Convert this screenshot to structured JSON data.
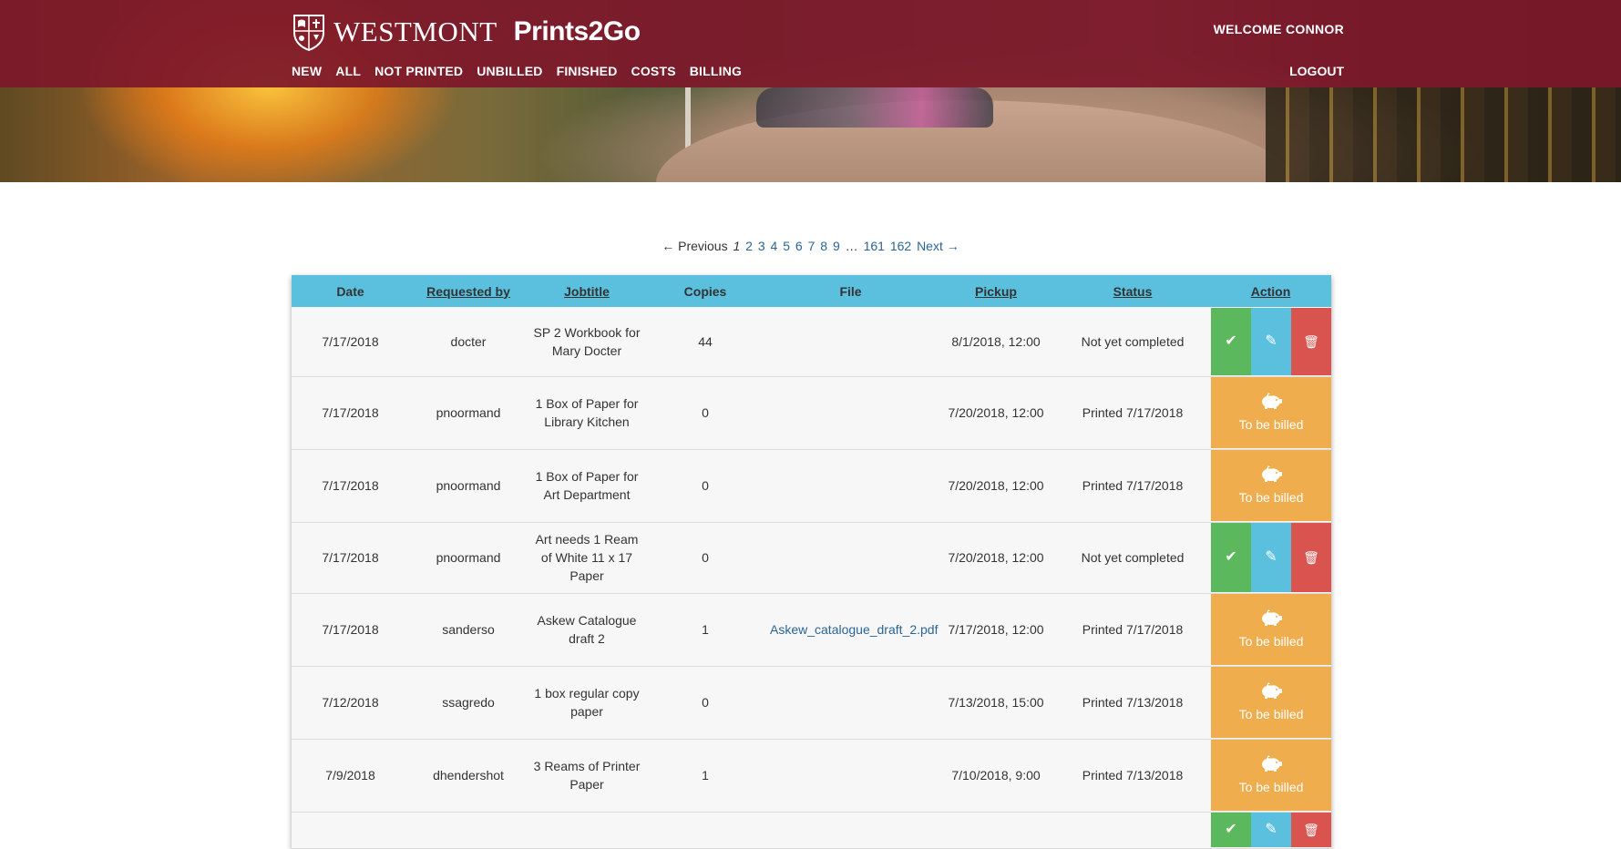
{
  "brand": {
    "wordmark": "WESTMONT",
    "app_name": "Prints2Go",
    "shield_icon": "westmont-shield-icon"
  },
  "header": {
    "welcome": "WELCOME CONNOR",
    "logout": "LOGOUT",
    "nav": [
      "NEW",
      "ALL",
      "NOT PRINTED",
      "UNBILLED",
      "FINISHED",
      "COSTS",
      "BILLING"
    ],
    "bar_color": "#7d182a"
  },
  "pagination": {
    "previous": "← Previous",
    "current": "1",
    "pages_before_gap": [
      "2",
      "3",
      "4",
      "5",
      "6",
      "7",
      "8",
      "9"
    ],
    "gap": "…",
    "pages_after_gap": [
      "161",
      "162"
    ],
    "next": "Next →"
  },
  "table": {
    "columns": [
      "Date",
      "Requested by",
      "Jobtitle",
      "Copies",
      "File",
      "Pickup",
      "Status",
      "Action"
    ],
    "sortable": [
      false,
      true,
      true,
      false,
      false,
      true,
      true,
      true
    ],
    "rows": [
      {
        "date": "7/17/2018",
        "requested_by": "docter",
        "jobtitle": "SP 2 Workbook for Mary Docter",
        "copies": "44",
        "file": "",
        "pickup": "8/1/2018, 12:00",
        "status": "Not yet completed",
        "action": "buttons"
      },
      {
        "date": "7/17/2018",
        "requested_by": "pnoormand",
        "jobtitle": "1 Box of Paper for Library Kitchen",
        "copies": "0",
        "file": "",
        "pickup": "7/20/2018, 12:00",
        "status": "Printed 7/17/2018",
        "action": "bill"
      },
      {
        "date": "7/17/2018",
        "requested_by": "pnoormand",
        "jobtitle": "1 Box of Paper for Art Department",
        "copies": "0",
        "file": "",
        "pickup": "7/20/2018, 12:00",
        "status": "Printed 7/17/2018",
        "action": "bill"
      },
      {
        "date": "7/17/2018",
        "requested_by": "pnoormand",
        "jobtitle": "Art needs 1 Ream of White 11 x 17 Paper",
        "copies": "0",
        "file": "",
        "pickup": "7/20/2018, 12:00",
        "status": "Not yet completed",
        "action": "buttons"
      },
      {
        "date": "7/17/2018",
        "requested_by": "sanderso",
        "jobtitle": "Askew Catalogue draft 2",
        "copies": "1",
        "file": "Askew_catalogue_draft_2.pdf",
        "pickup": "7/17/2018, 12:00",
        "status": "Printed 7/17/2018",
        "action": "bill"
      },
      {
        "date": "7/12/2018",
        "requested_by": "ssagredo",
        "jobtitle": "1 box regular copy paper",
        "copies": "0",
        "file": "",
        "pickup": "7/13/2018, 15:00",
        "status": "Printed 7/13/2018",
        "action": "bill"
      },
      {
        "date": "7/9/2018",
        "requested_by": "dhendershot",
        "jobtitle": "3 Reams of Printer Paper",
        "copies": "1",
        "file": "",
        "pickup": "7/10/2018, 9:00",
        "status": "Printed 7/13/2018",
        "action": "bill"
      },
      {
        "date": "",
        "requested_by": "",
        "jobtitle": "",
        "copies": "",
        "file": "",
        "pickup": "",
        "status": "",
        "action": "buttons"
      }
    ],
    "bill_label": "To be billed",
    "icons": {
      "complete": "checkmark-icon",
      "edit": "pencil-icon",
      "delete": "trash-icon",
      "bill": "piggy-bank-icon"
    },
    "colors": {
      "header": "#5bc0de",
      "complete": "#5cb85c",
      "edit": "#5bc0de",
      "delete": "#d9534f",
      "bill": "#f0ad4e"
    }
  }
}
